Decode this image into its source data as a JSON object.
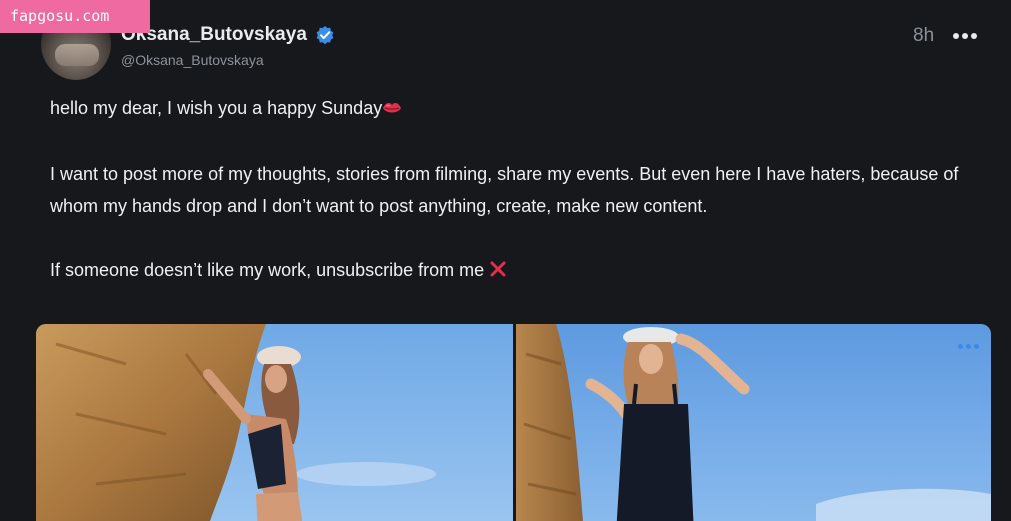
{
  "watermark": "fapgosu.com",
  "user": {
    "display_name": "Oksana_Butovskaya",
    "handle": "@Oksana_Butovskaya",
    "verified_icon": "verified-check-icon",
    "verified_color": "#3b8ee8"
  },
  "post": {
    "timestamp": "8h",
    "more_icon": "more-horizontal-icon",
    "line1": "hello my dear, I wish you a happy Sunday",
    "line1_emoji_icon": "kiss-lips-icon",
    "paragraph2": "I want to post more of my thoughts, stories from filming, share my events. But even here I have haters, because of whom my hands drop and I don’t want to post anything, create, make new content.",
    "line3": "If someone doesn’t like my work, unsubscribe from me",
    "line3_emoji_icon": "cross-mark-icon"
  },
  "media": {
    "items": [
      {
        "kind": "photo",
        "icon": "photo-left"
      },
      {
        "kind": "photo",
        "icon": "photo-right"
      }
    ],
    "photo_more_icon": "more-horizontal-icon",
    "accent_color": "#3a8be8"
  },
  "colors": {
    "background": "#16181c",
    "watermark_bg": "#ef6aa0",
    "text": "#eef0f3",
    "muted": "#8b939c"
  }
}
